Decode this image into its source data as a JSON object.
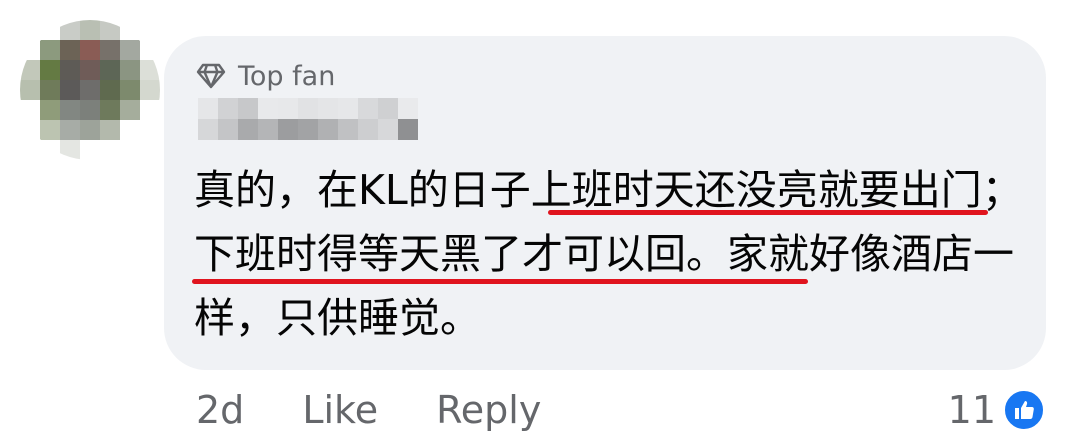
{
  "comment": {
    "badge": {
      "icon": "diamond-icon",
      "label": "Top fan"
    },
    "text": "真的，在KL的日子上班时天还没亮就要出门；下班时得等天黑了才可以回。家就好像酒店一样，只供睡觉。",
    "highlight_color": "#e0141e"
  },
  "actions": {
    "timestamp": "2d",
    "like_label": "Like",
    "reply_label": "Reply"
  },
  "reactions": {
    "count": "11",
    "icon": "thumbs-up-icon",
    "color": "#1877f2"
  },
  "colors": {
    "bubble": "#f0f2f5",
    "secondary_text": "#65676b",
    "primary_text": "#050505"
  }
}
